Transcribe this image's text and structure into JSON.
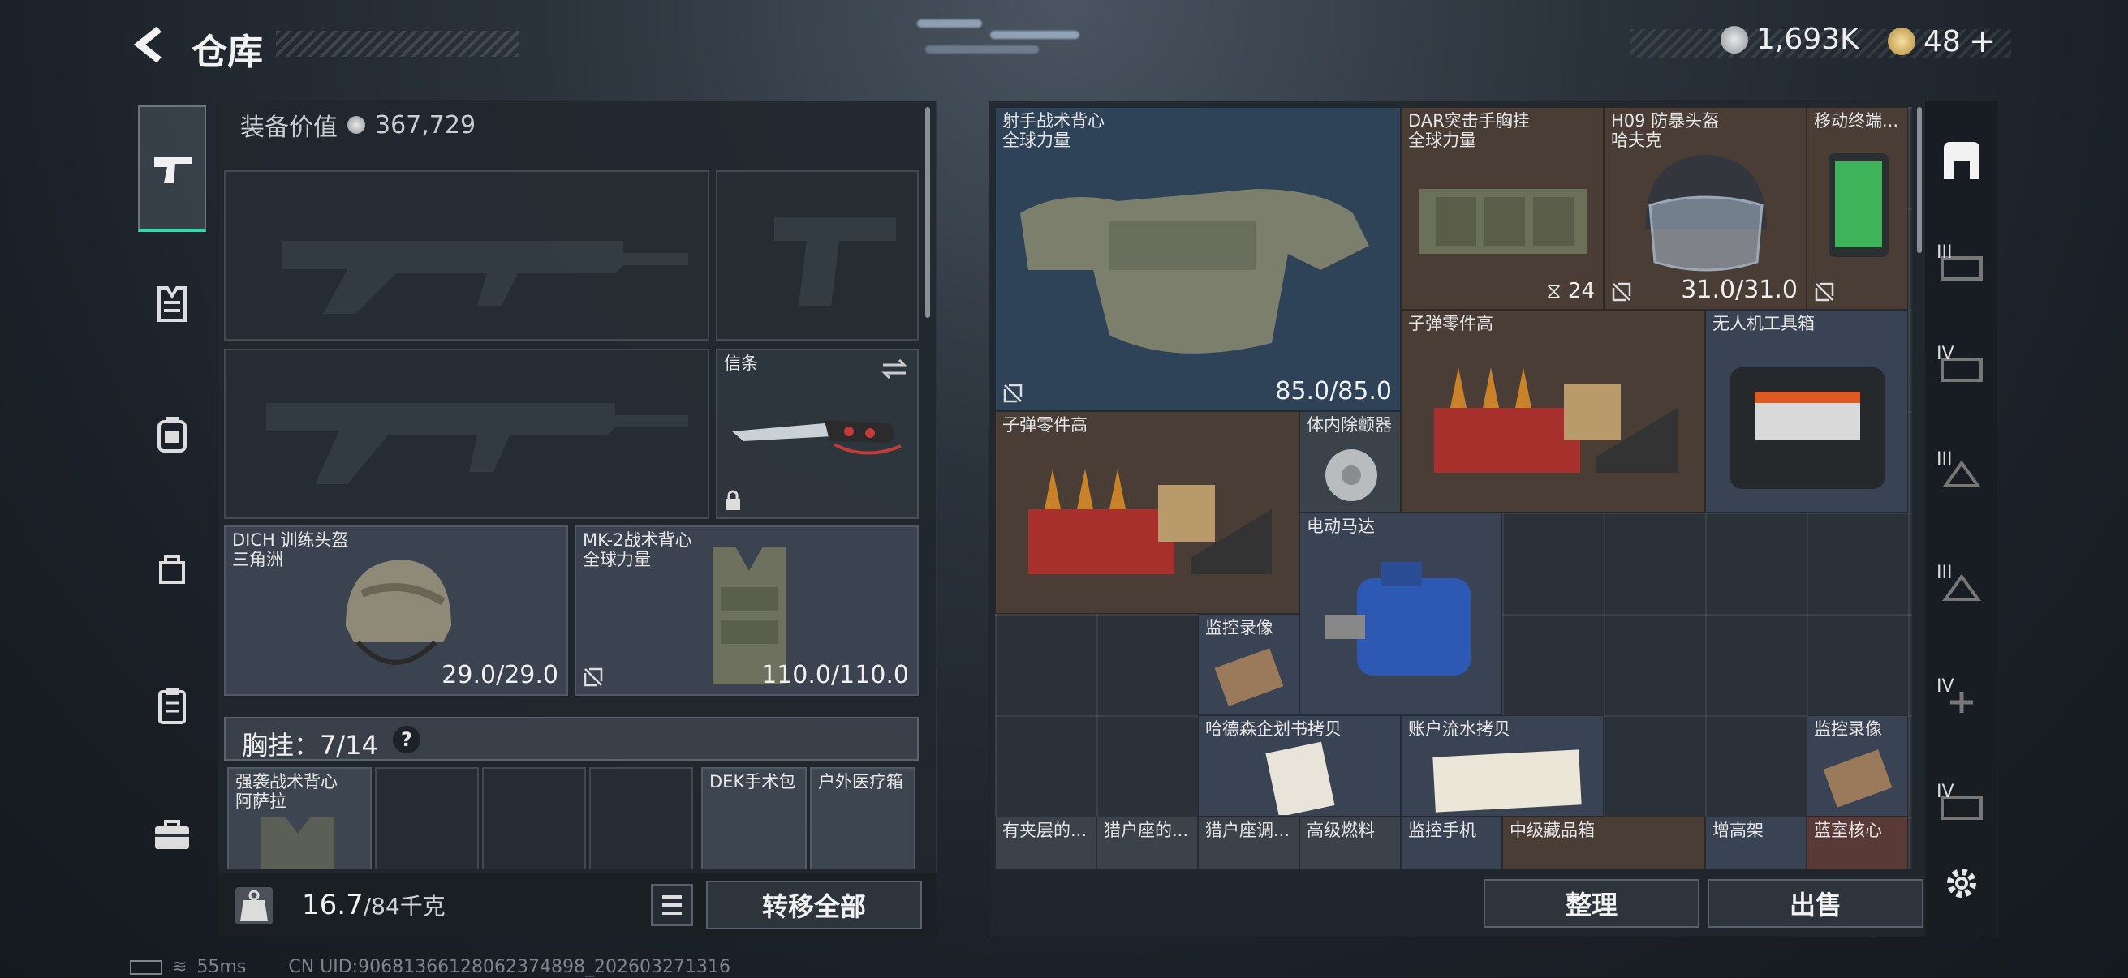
{
  "header": {
    "title": "仓库",
    "currency1": "1,693K",
    "currency2": "48"
  },
  "loadout": {
    "equip_label": "装备价值",
    "equip_value": "367,729",
    "melee_name": "信条",
    "helmet": {
      "name": "DICH 训练头盔",
      "sub": "三角洲",
      "durability": "29.0/29.0"
    },
    "vest": {
      "name": "MK-2战术背心",
      "sub": "全球力量",
      "durability": "110.0/110.0"
    },
    "rig_label": "胸挂：7/14",
    "rig_items": [
      "强袭战术背心",
      "DEK手术包",
      "户外医疗箱"
    ],
    "rig_item0_sub": "阿萨拉",
    "weight_value": "16.7",
    "weight_max": "/84千克",
    "transfer_all": "转移全部"
  },
  "stash": {
    "items": [
      {
        "name": "射手战术背心",
        "sub": "全球力量",
        "durability": "85.0/85.0"
      },
      {
        "name": "DAR突击手胸挂",
        "sub": "全球力量",
        "count": "24"
      },
      {
        "name": "H09 防暴头盔",
        "sub": "哈夫克",
        "durability": "31.0/31.0"
      },
      {
        "name": "移动终端..."
      },
      {
        "name": "子弹零件高"
      },
      {
        "name": "无人机工具箱"
      },
      {
        "name": "子弹零件高"
      },
      {
        "name": "体内除颤器"
      },
      {
        "name": "电动马达"
      },
      {
        "name": "监控录像"
      },
      {
        "name": "哈德森企划书拷贝"
      },
      {
        "name": "账户流水拷贝"
      },
      {
        "name": "监控录像"
      },
      {
        "name": "有夹层的..."
      },
      {
        "name": "猎户座的..."
      },
      {
        "name": "猎户座调..."
      },
      {
        "name": "高级燃料"
      },
      {
        "name": "监控手机"
      },
      {
        "name": "中级藏品箱"
      },
      {
        "name": "增高架"
      },
      {
        "name": "蓝室核心"
      }
    ],
    "sort_btn": "整理",
    "sell_btn": "出售"
  },
  "status": {
    "ping": "55ms",
    "uid": "CN UID:90681366128062374898_202603271316"
  },
  "right_tabs": [
    "III",
    "IV",
    "III",
    "III",
    "IV",
    "IV"
  ]
}
